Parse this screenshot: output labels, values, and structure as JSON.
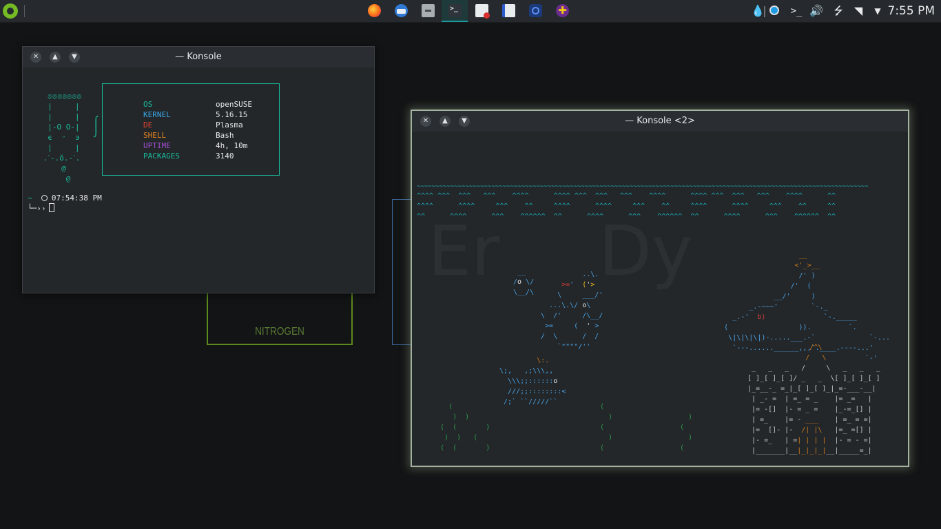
{
  "panel": {
    "clock": "7:55 PM",
    "tasks": [
      {
        "name": "firefox-icon"
      },
      {
        "name": "thunderbird-icon"
      },
      {
        "name": "file-manager-icon"
      },
      {
        "name": "konsole-icon"
      },
      {
        "name": "document-viewer-icon"
      },
      {
        "name": "text-editor-icon"
      },
      {
        "name": "network-app-icon"
      },
      {
        "name": "help-icon"
      }
    ]
  },
  "desktop": {
    "nitrogen_letter": "N",
    "nitrogen_label": "NITROGEN"
  },
  "konsole1": {
    "title": "— Konsole",
    "logo": "  ෧෧෧෧෧෧෧\n  |     |\n  |     |\n  |-O O-|\n  ϵ  ᵕ  э\n  |     |\n .ˋ-.ŏ.-ˊ.\n     @\n      @",
    "info": [
      {
        "key": "OS",
        "value": "openSUSE",
        "color": "#1abc9c"
      },
      {
        "key": "KERNEL",
        "value": "5.16.15",
        "color": "#3ba5e3"
      },
      {
        "key": "DE",
        "value": "Plasma",
        "color": "#d9422f"
      },
      {
        "key": "SHELL",
        "value": "Bash",
        "color": "#e6821f"
      },
      {
        "key": "UPTIME",
        "value": "4h, 10m",
        "color": "#a04fd0"
      },
      {
        "key": "PACKAGES",
        "value": "3140",
        "color": "#1abc9c"
      }
    ],
    "prompt_dir": "~",
    "prompt_time": "07:54:38 PM",
    "prompt_symbol": "└─››"
  },
  "konsole2": {
    "title": "— Konsole <2>",
    "waterline": "~~~~~~~~~~~~~~~~~~~~~~~~~~~~~~~~~~~~~~~~~~~~~~~~~~~~~~~~~~~~~~~~~~~~~~~~~~~~~~~~~~~~~~~~~~~~~~~~~~~~~~~~~~~~~~~~~~~~~~~~~",
    "waves1": "^^^^ ^^^  ^^^   ^^^    ^^^^      ^^^^ ^^^  ^^^   ^^^    ^^^^      ^^^^ ^^^  ^^^   ^^^    ^^^^      ^^",
    "waves2": "^^^^      ^^^^     ^^^    ^^     ^^^^      ^^^^     ^^^    ^^     ^^^^      ^^^^     ^^^    ^^     ^^",
    "waves3": "^^      ^^^^      ^^^    ^^^^^^  ^^      ^^^^      ^^^    ^^^^^^  ^^      ^^^^      ^^^    ^^^^^^  ^^",
    "ghost_left": "Er",
    "ghost_right": "Dy"
  }
}
